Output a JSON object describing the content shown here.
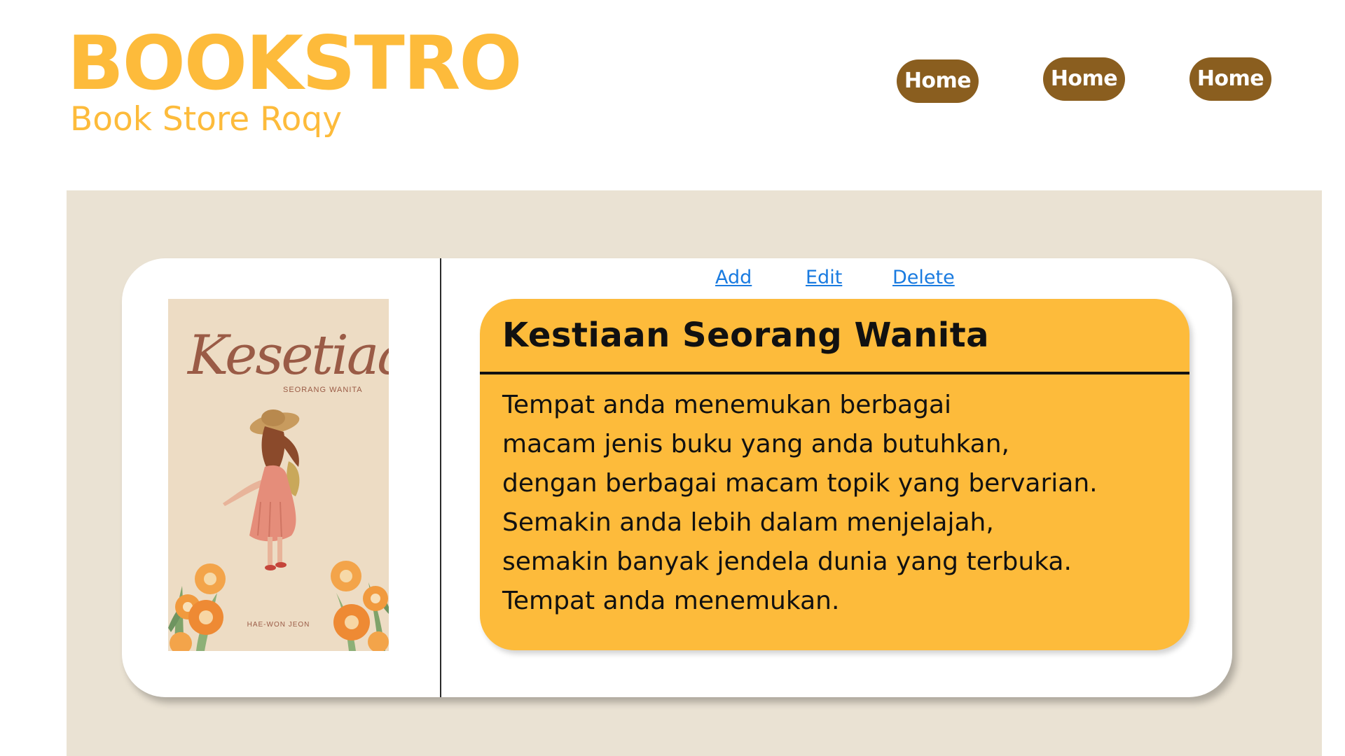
{
  "header": {
    "brand_title": "BOOKSTRO",
    "brand_subtitle": "Book Store Roqy",
    "nav": [
      "Home",
      "Home",
      "Home"
    ]
  },
  "colors": {
    "brand_yellow": "#FDBB3B",
    "nav_brown": "#8A5E1F",
    "panel_beige": "#EAE2D3",
    "link_blue": "#1A7BE0",
    "card_white": "#FFFFFF"
  },
  "book": {
    "cover": {
      "title": "Kesetiaan",
      "subtitle": "SEORANG WANITA",
      "author": "HAE-WON JEON"
    },
    "actions": {
      "add": "Add",
      "edit": "Edit",
      "delete": "Delete"
    },
    "title": "Kestiaan Seorang Wanita",
    "description_lines": [
      "Tempat anda menemukan berbagai",
      "macam jenis buku yang anda butuhkan,",
      "dengan berbagai macam topik yang bervarian.",
      "Semakin anda lebih dalam menjelajah,",
      "semakin banyak jendela dunia yang terbuka.",
      "Tempat anda menemukan."
    ]
  }
}
